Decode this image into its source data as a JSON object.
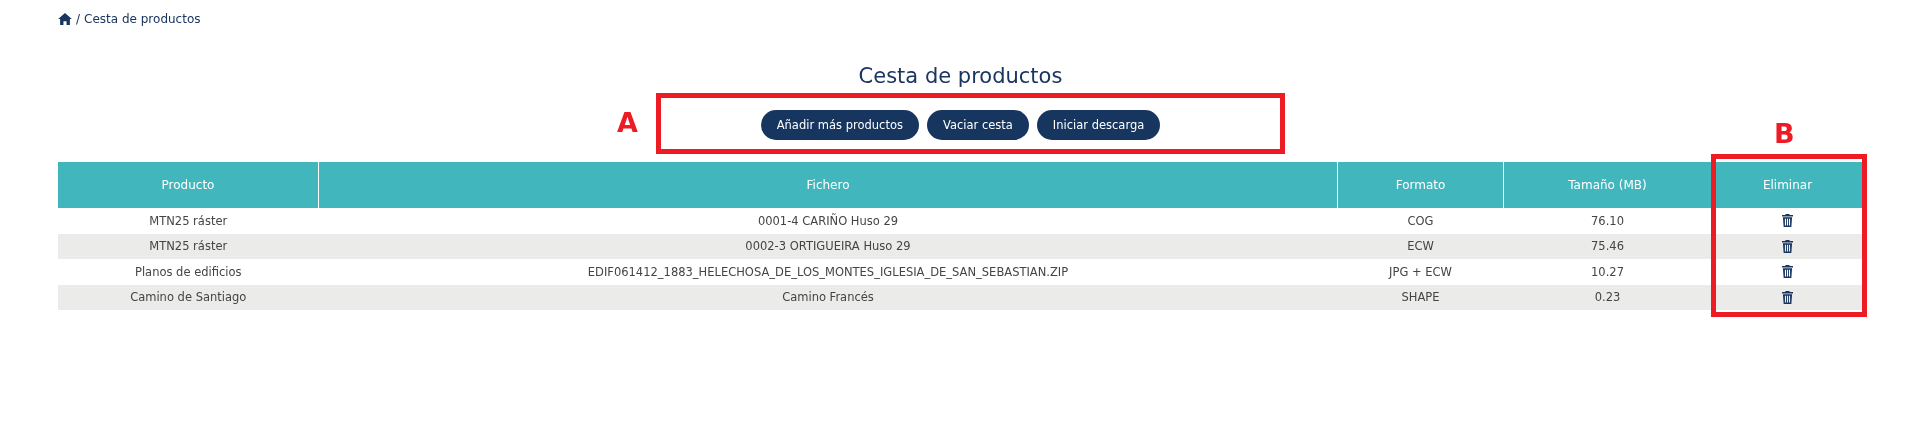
{
  "breadcrumb": {
    "separator": "/",
    "current": "Cesta de productos"
  },
  "title": "Cesta de productos",
  "buttons": [
    "Añadir más productos",
    "Vaciar cesta",
    "Iniciar descarga"
  ],
  "table": {
    "columns": [
      "Producto",
      "Fichero",
      "Formato",
      "Tamaño (MB)",
      "Eliminar"
    ],
    "rows": [
      {
        "producto": "MTN25 ráster",
        "fichero": "0001-4 CARIÑO Huso 29",
        "formato": "COG",
        "tamano": "76.10"
      },
      {
        "producto": "MTN25 ráster",
        "fichero": "0002-3 ORTIGUEIRA Huso 29",
        "formato": "ECW",
        "tamano": "75.46"
      },
      {
        "producto": "Planos de edificios",
        "fichero": "EDIF061412_1883_HELECHOSA_DE_LOS_MONTES_IGLESIA_DE_SAN_SEBASTIAN.ZIP",
        "formato": "JPG + ECW",
        "tamano": "10.27"
      },
      {
        "producto": "Camino de Santiago",
        "fichero": "Camino Francés",
        "formato": "SHAPE",
        "tamano": "0.23"
      }
    ]
  },
  "annotations": [
    {
      "label": "A"
    },
    {
      "label": "B"
    }
  ]
}
